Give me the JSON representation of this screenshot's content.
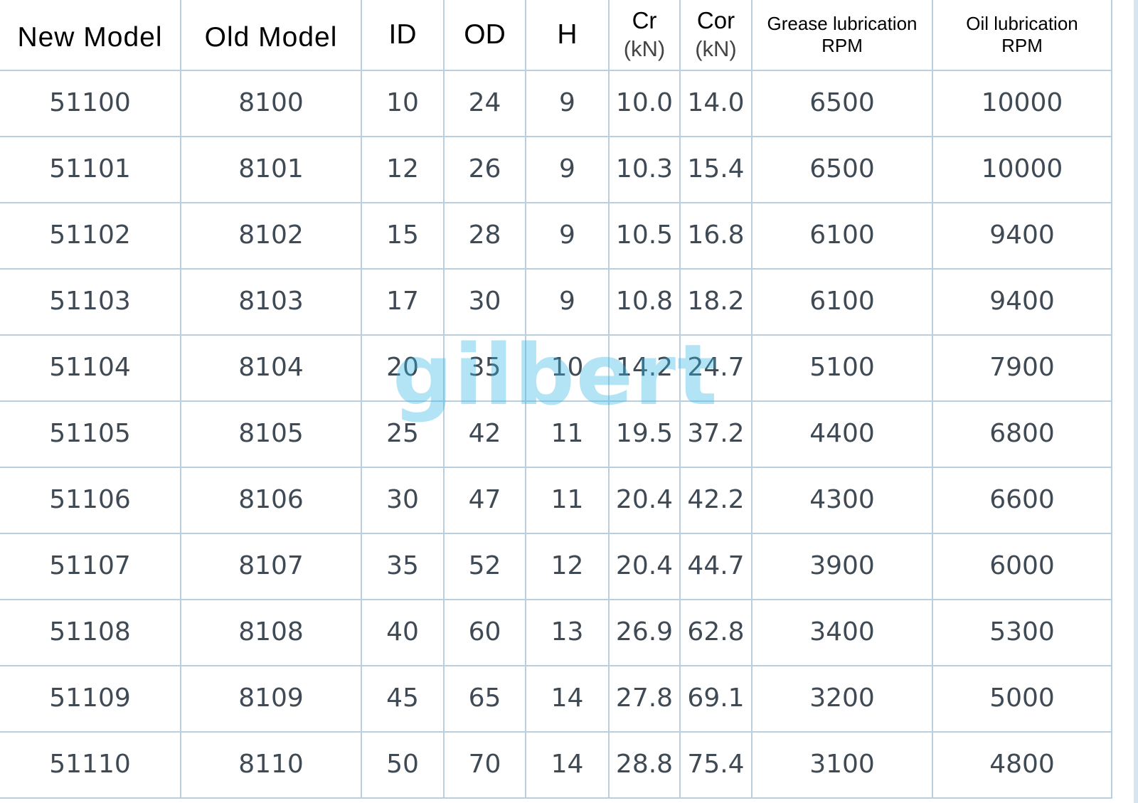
{
  "table": {
    "headers": [
      {
        "line1": "New Model",
        "line2": ""
      },
      {
        "line1": "Old Model",
        "line2": ""
      },
      {
        "line1": "ID",
        "line2": ""
      },
      {
        "line1": "OD",
        "line2": ""
      },
      {
        "line1": "H",
        "line2": ""
      },
      {
        "line1": "Cr",
        "line2": "(kN)"
      },
      {
        "line1": "Cor",
        "line2": "(kN)"
      },
      {
        "line1": "Grease lubrication",
        "line2": "RPM"
      },
      {
        "line1": "Oil lubrication",
        "line2": "RPM"
      }
    ],
    "rows": [
      [
        "51100",
        "8100",
        "10",
        "24",
        "9",
        "10.0",
        "14.0",
        "6500",
        "10000"
      ],
      [
        "51101",
        "8101",
        "12",
        "26",
        "9",
        "10.3",
        "15.4",
        "6500",
        "10000"
      ],
      [
        "51102",
        "8102",
        "15",
        "28",
        "9",
        "10.5",
        "16.8",
        "6100",
        "9400"
      ],
      [
        "51103",
        "8103",
        "17",
        "30",
        "9",
        "10.8",
        "18.2",
        "6100",
        "9400"
      ],
      [
        "51104",
        "8104",
        "20",
        "35",
        "10",
        "14.2",
        "24.7",
        "5100",
        "7900"
      ],
      [
        "51105",
        "8105",
        "25",
        "42",
        "11",
        "19.5",
        "37.2",
        "4400",
        "6800"
      ],
      [
        "51106",
        "8106",
        "30",
        "47",
        "11",
        "20.4",
        "42.2",
        "4300",
        "6600"
      ],
      [
        "51107",
        "8107",
        "35",
        "52",
        "12",
        "20.4",
        "44.7",
        "3900",
        "6000"
      ],
      [
        "51108",
        "8108",
        "40",
        "60",
        "13",
        "26.9",
        "62.8",
        "3400",
        "5300"
      ],
      [
        "51109",
        "8109",
        "45",
        "65",
        "14",
        "27.8",
        "69.1",
        "3200",
        "5000"
      ],
      [
        "51110",
        "8110",
        "50",
        "70",
        "14",
        "28.8",
        "75.4",
        "3100",
        "4800"
      ]
    ]
  },
  "watermark": {
    "text": "gilbert"
  },
  "colors": {
    "grid_line": "#b9cfe0",
    "cell_text": "#3f4a55",
    "header_text": "#000000",
    "watermark": "#34b7e6"
  }
}
